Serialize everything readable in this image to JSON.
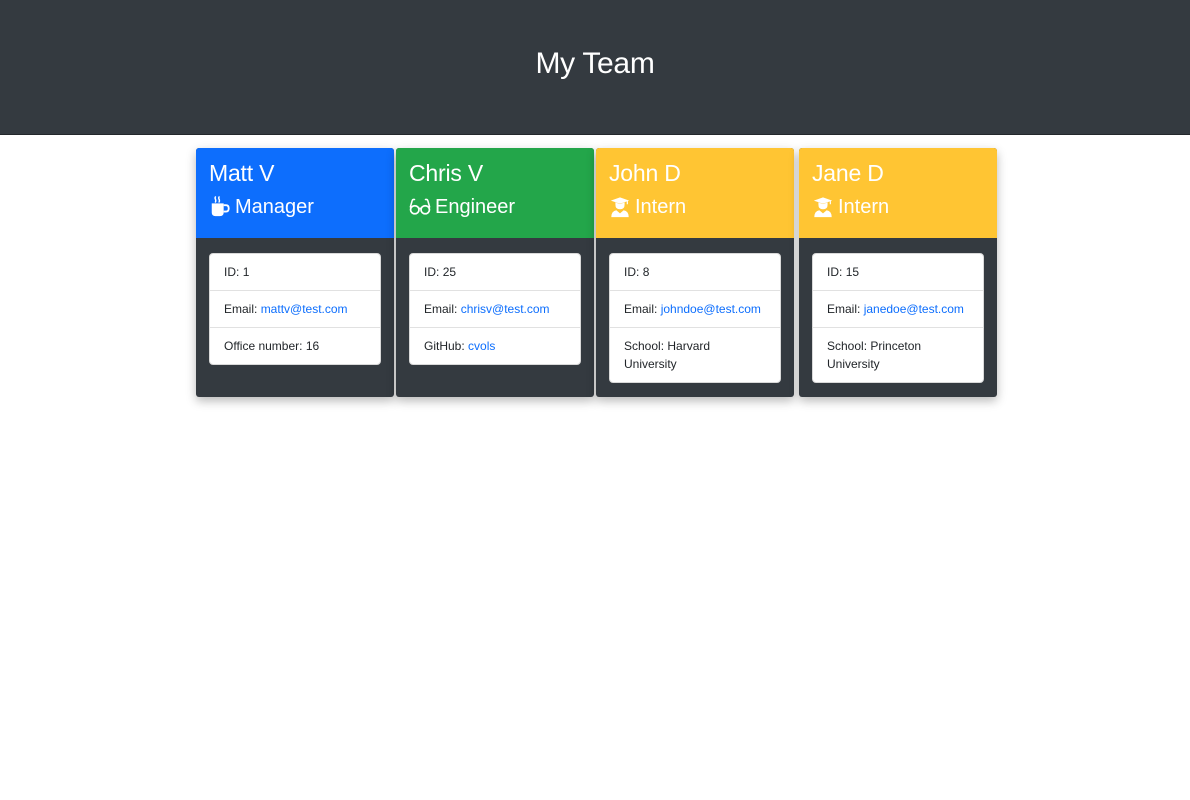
{
  "page": {
    "title": "My Team"
  },
  "colors": {
    "manager": "#0d6efd",
    "engineer": "#23a64a",
    "intern": "#ffc533",
    "dark": "#343a40"
  },
  "cards": [
    {
      "name": "Matt V",
      "role": "Manager",
      "icon": "mug-icon",
      "id_label": "ID:",
      "id": "1",
      "email_label": "Email:",
      "email": "mattv@test.com",
      "extra_label": "Office number:",
      "extra": "16"
    },
    {
      "name": "Chris V",
      "role": "Engineer",
      "icon": "glasses-icon",
      "id_label": "ID:",
      "id": "25",
      "email_label": "Email:",
      "email": "chrisv@test.com",
      "extra_label": "GitHub:",
      "extra": "cvols"
    },
    {
      "name": "John D",
      "role": "Intern",
      "icon": "graduate-icon",
      "id_label": "ID:",
      "id": "8",
      "email_label": "Email:",
      "email": "johndoe@test.com",
      "extra_label": "School:",
      "extra": "Harvard University"
    },
    {
      "name": "Jane D",
      "role": "Intern",
      "icon": "graduate-icon",
      "id_label": "ID:",
      "id": "15",
      "email_label": "Email:",
      "email": "janedoe@test.com",
      "extra_label": "School:",
      "extra": "Princeton University"
    }
  ]
}
